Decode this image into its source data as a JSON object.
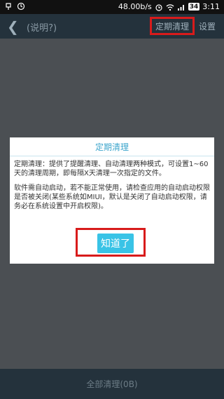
{
  "status": {
    "speed": "48.00b/s",
    "battery": "34",
    "time": "3:11"
  },
  "titlebar": {
    "title": "(说明?)",
    "schedule_label": "定期清理",
    "settings_label": "设置"
  },
  "dialog": {
    "title": "定期清理",
    "para1": "定期清理：提供了提醒清理、自动清理两种模式，可设置1~60天的清理周期，即每隔X天清理一次指定的文件。",
    "para2": "软件需自动启动，若不能正常使用，请检查应用的自动启动权限是否被关闭(某些系统如MIUI，默认是关闭了自动启动权限，请务必在系统设置中开启权限)。",
    "confirm_label": "知道了"
  },
  "bottom": {
    "clean_all_label": "全部清理(0B)"
  }
}
